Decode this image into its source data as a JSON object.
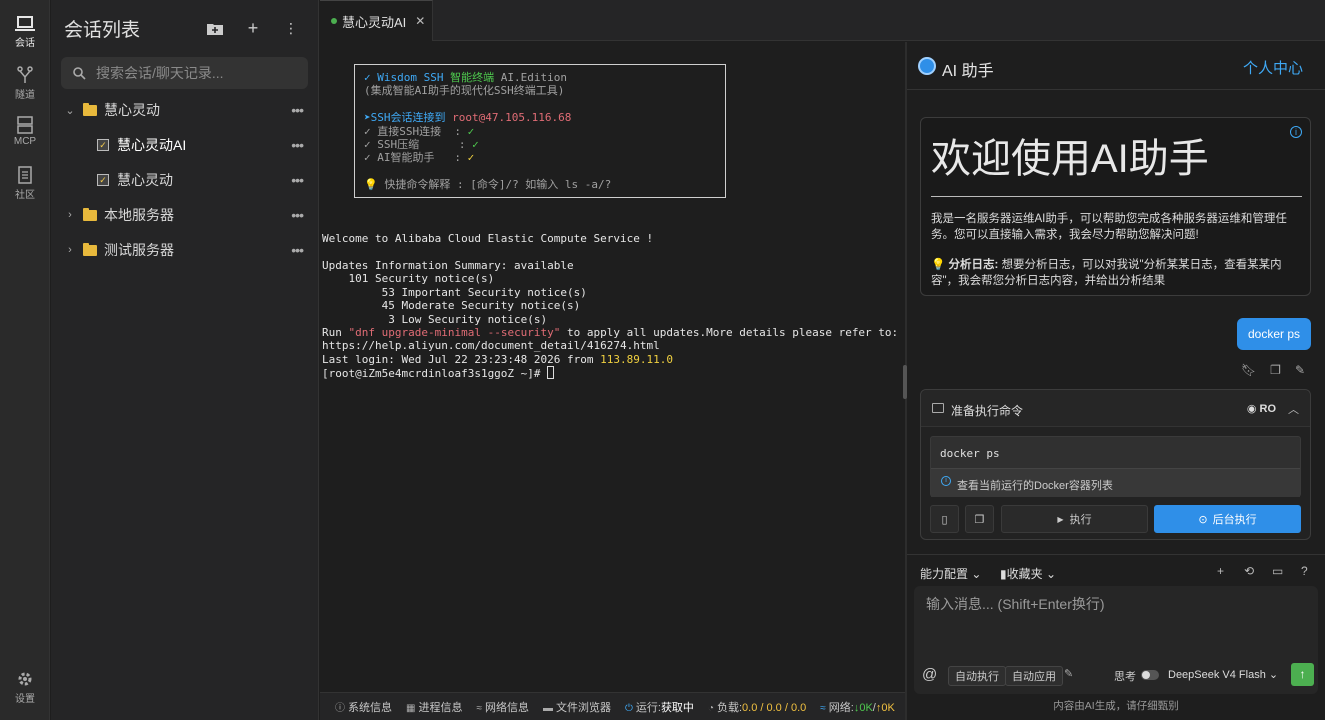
{
  "activity_bar": {
    "items": [
      {
        "label": "会话",
        "icon": "laptop-icon"
      },
      {
        "label": "隧道",
        "icon": "tunnel-icon"
      },
      {
        "label": "MCP",
        "icon": "server-icon"
      },
      {
        "label": "社区",
        "icon": "document-icon"
      }
    ],
    "settings_label": "设置"
  },
  "sidebar": {
    "title": "会话列表",
    "search_placeholder": "搜索会话/聊天记录...",
    "groups": [
      {
        "label": "慧心灵动",
        "expanded": true,
        "children": [
          "慧心灵动AI",
          "慧心灵动"
        ]
      },
      {
        "label": "本地服务器",
        "expanded": false
      },
      {
        "label": "测试服务器",
        "expanded": false
      }
    ]
  },
  "tabs": [
    {
      "label": "慧心灵动AI",
      "status_color": "#4caf50"
    }
  ],
  "terminal": {
    "banner": {
      "title_check": "✓",
      "title_brand": "Wisdom SSH",
      "title_name": "智能终端",
      "title_edition": "AI.Edition",
      "subtitle": "(集成智能AI助手的现代化SSH终端工具)",
      "connect_arrow": "➤",
      "connect_label": "SSH会话连接到",
      "connect_target": "root@47.105.116.68",
      "features": [
        {
          "name": "直接SSH连接",
          "mark": "✓"
        },
        {
          "name": "SSH压缩",
          "mark": "✓"
        },
        {
          "name": "AI智能助手",
          "mark": "✓"
        }
      ],
      "hint": "快捷命令解释 : [命令]/? 如输入 ls -a/?"
    },
    "lines": {
      "welcome": "Welcome to Alibaba Cloud Elastic Compute Service !",
      "updates": "Updates Information Summary: available",
      "sec101": "    101 Security notice(s)",
      "sec53": "         53 Important Security notice(s)",
      "sec45": "         45 Moderate Security notice(s)",
      "sec3": "          3 Low Security notice(s)",
      "run_prefix": "Run ",
      "run_cmd": "\"dnf upgrade-minimal --security\"",
      "run_suffix": " to apply all updates.More details please refer to:",
      "url": "https://help.aliyun.com/document_detail/416274.html",
      "last_login_prefix": "Last login: Wed Jul 22 23:23:48 2026 from ",
      "last_login_ip": "113.89.11.0",
      "prompt": "[root@iZm5e4mcrdinloaf3s1ggoZ ~]# "
    }
  },
  "statusbar": {
    "sysinfo": "系统信息",
    "process": "进程信息",
    "network": "网络信息",
    "files": "文件浏览器",
    "run_label": "运行:",
    "run_value": "获取中",
    "load_label": "负载:",
    "load_value": "0.0 / 0.0 / 0.0",
    "net_label": "网络:",
    "net_down": "↓0K",
    "net_up": "↑0K"
  },
  "ai_panel": {
    "title": "AI 助手",
    "user_center": "个人中心",
    "welcome_title": "欢迎使用AI助手",
    "welcome_body": "我是一名服务器运维AI助手，可以帮助您完成各种服务器运维和管理任务。您可以直接输入需求，我会尽力帮助您解决问题!",
    "tip_label": "分析日志:",
    "tip_body": "想要分析日志，可以对我说\"分析某某日志，查看某某内容\"，我会帮您分析日志内容，并给出分析结果",
    "user_message": "docker ps",
    "command_card": {
      "title": "准备执行命令",
      "mode": "RO",
      "command": "docker ps",
      "description": "查看当前运行的Docker容器列表",
      "run_label": "执行",
      "bg_run_label": "后台执行"
    },
    "toolbar": {
      "capability": "能力配置",
      "favorites": "收藏夹"
    },
    "input_placeholder": "输入消息... (Shift+Enter换行)",
    "chips": {
      "auto_exec": "自动执行",
      "auto_apply": "自动应用"
    },
    "think_label": "思考",
    "model": "DeepSeek V4 Flash",
    "footer": "内容由AI生成，请仔细甄别"
  },
  "colors": {
    "accent": "#2f8fe8",
    "success": "#4caf50",
    "folder": "#e8b93c"
  }
}
